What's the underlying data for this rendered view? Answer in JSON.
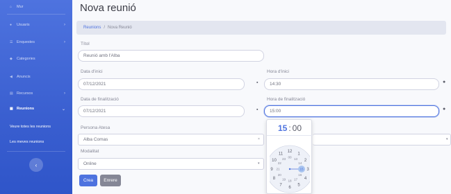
{
  "sidebar": {
    "items": [
      {
        "label": "Mur",
        "icon": "home-icon",
        "chevron": ""
      },
      {
        "label": "Usuaris",
        "icon": "users-icon",
        "chevron": "›"
      },
      {
        "label": "Enquestes",
        "icon": "list-icon",
        "chevron": "›"
      },
      {
        "label": "Categories",
        "icon": "tag-icon",
        "chevron": ""
      },
      {
        "label": "Anuncis",
        "icon": "megaphone-icon",
        "chevron": ""
      },
      {
        "label": "Recursos",
        "icon": "folder-icon",
        "chevron": "›"
      },
      {
        "label": "Reunions",
        "icon": "calendar-icon",
        "chevron": "⌄"
      }
    ],
    "sub_items": [
      "Veure totes les reunions",
      "Les meves reunions"
    ],
    "toggle_glyph": "‹"
  },
  "page": {
    "title": "Nova reunió",
    "breadcrumb": {
      "link": "Reunions",
      "separator": "/",
      "current": "Nova Reunió"
    }
  },
  "form": {
    "titol": {
      "label": "Títol",
      "value": "Reunió amb l'Alba"
    },
    "data_inici": {
      "label": "Data d'inici",
      "value": "07/12/2021",
      "icon": "calendar-icon"
    },
    "hora_inici": {
      "label": "Hora d'inici",
      "value": "14:30",
      "icon": "clock-icon"
    },
    "data_fin": {
      "label": "Data de finalització",
      "value": "07/12/2021",
      "icon": "calendar-icon"
    },
    "hora_fin": {
      "label": "Hora de finalització",
      "value": "15:00",
      "icon": "clock-icon"
    },
    "persona": {
      "label": "Persona Atesa",
      "value": "Alba Comas"
    },
    "modalitat": {
      "label": "Modalitat",
      "value": "Online"
    },
    "buttons": {
      "create": "Crea",
      "back": "Enrere"
    }
  },
  "timepicker": {
    "hour": "15",
    "separator": ":",
    "minutes": "00",
    "selected_hour": 15,
    "outer_hours": [
      "12",
      "1",
      "2",
      "3",
      "4",
      "5",
      "6",
      "7",
      "8",
      "9",
      "10",
      "11"
    ],
    "inner_hours": [
      "00",
      "13",
      "14",
      "15",
      "16",
      "17",
      "18",
      "19",
      "20",
      "21",
      "22",
      "23"
    ]
  },
  "colors": {
    "primary": "#4e73df",
    "secondary": "#858796",
    "sidebar": "#4e73df"
  }
}
